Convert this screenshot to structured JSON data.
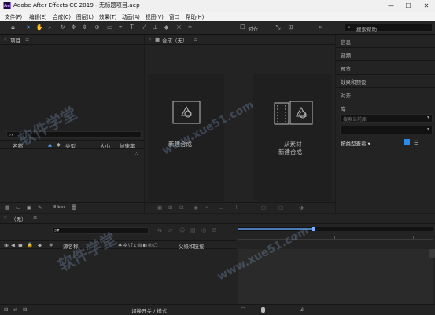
{
  "window": {
    "title": "Adobe After Effects CC 2019 - 无标题项目.aep",
    "logo": "Ae",
    "controls": [
      "—",
      "☐",
      "✕"
    ]
  },
  "menu": [
    "文件(F)",
    "编辑(E)",
    "合成(C)",
    "图层(L)",
    "效果(T)",
    "动画(A)",
    "视图(V)",
    "窗口",
    "帮助(H)"
  ],
  "toolbar": {
    "snap_label": "对齐",
    "search_placeholder": "搜索帮助"
  },
  "project_panel": {
    "title": "项目",
    "search_glyph": "⌕▾",
    "columns": [
      "名称",
      "类型",
      "大小",
      "帧速率"
    ],
    "bpc": "8 bpc"
  },
  "comp_panel": {
    "tab": "合成（无）",
    "new_comp": "新建合成",
    "from_footage_line1": "从素材",
    "from_footage_line2": "新建合成"
  },
  "right_panel": {
    "items": [
      "信息",
      "音频",
      "预览",
      "效果和预设",
      "对齐",
      "库"
    ],
    "library_search_placeholder": "搜索当前库",
    "view_by": "按类型查看 ▾"
  },
  "timeline": {
    "tab": "（无）",
    "search_glyph": "⌕▾",
    "col_name": "源名称",
    "col_parent": "父级和链接",
    "toggle_mode": "切换开关 / 模式"
  },
  "watermarks": [
    "软件学堂",
    "www.xue51.com",
    "软件学堂",
    "www.xue51.com"
  ],
  "colors": {
    "accent": "#2d8ceb",
    "panel": "#232323",
    "bg": "#1b1b1b"
  }
}
